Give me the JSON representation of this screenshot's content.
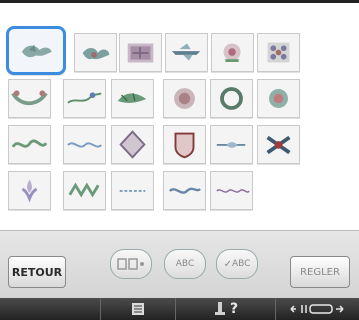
{
  "buttons": {
    "retour_label": "RETOUR",
    "regler_label": "REGLER"
  },
  "modes": {
    "abc_label": "ABC",
    "check_abc_label": "ABC"
  },
  "icons": {
    "tiles": [
      "bird-motif-icon",
      "insect-motif-icon",
      "tapestry-motif-icon",
      "dragonfly-motif-icon",
      "floral-motif-icon",
      "ornament-motif-icon",
      "swag-border-icon",
      "vine-border-icon",
      "leaf-border-icon",
      "medallion-motif-icon",
      "wreath-motif-icon",
      "rose-motif-icon",
      "scroll-border-icon",
      "lace-border-icon",
      "diamond-motif-icon",
      "shield-motif-icon",
      "arrow-border-icon",
      "crossed-motif-icon",
      "fleur-de-lis-icon",
      "crown-border-icon",
      "text-border-icon",
      "flourish-border-icon",
      "wave-border-icon"
    ]
  },
  "selected_tile": 0,
  "bottom_bar": {
    "icons": [
      "settings-list-icon",
      "help-icon",
      "thread-position-icon"
    ],
    "help_label": "?"
  },
  "colors": {
    "selected_border": "#3a8de0",
    "bottom_bar_bg": "#2a2a2a"
  }
}
